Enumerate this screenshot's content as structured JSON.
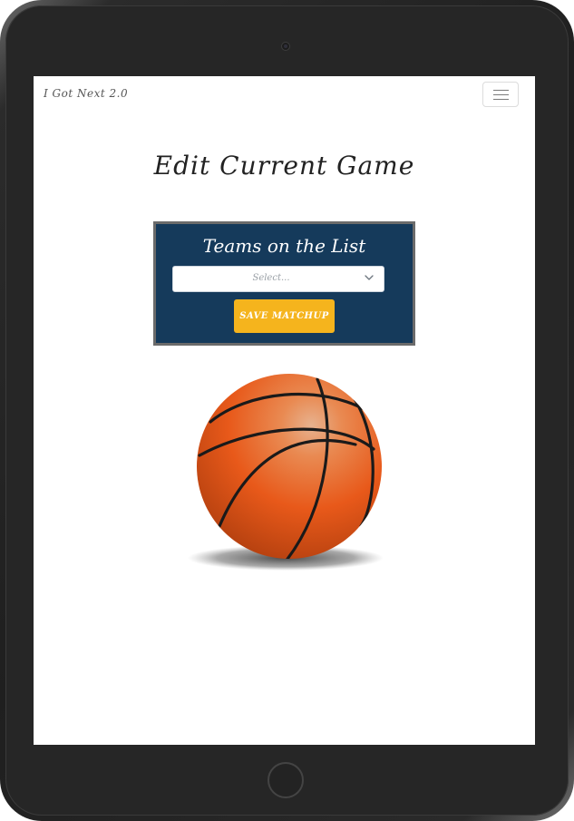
{
  "app": {
    "brand": "I Got Next 2.0"
  },
  "page": {
    "title": "Edit Current Game"
  },
  "teams_panel": {
    "title": "Teams on the List",
    "select_value": "Select...",
    "save_label": "SAVE MATCHUP"
  },
  "colors": {
    "panel_bg": "#153a5b",
    "button_bg": "#f5b41d",
    "ball_orange": "#e8591a"
  },
  "icons": {
    "menu": "hamburger-icon",
    "select": "chevron-down-icon",
    "image": "basketball"
  }
}
